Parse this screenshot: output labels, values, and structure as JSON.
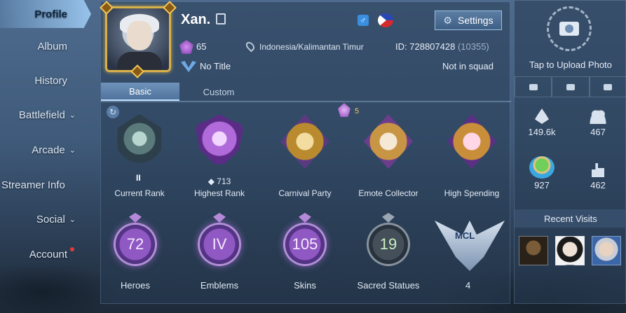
{
  "nav": {
    "items": [
      {
        "label": "Profile",
        "active": true,
        "chevron": false
      },
      {
        "label": "Album",
        "active": false,
        "chevron": false
      },
      {
        "label": "History",
        "active": false,
        "chevron": false
      },
      {
        "label": "Battlefield",
        "active": false,
        "chevron": true
      },
      {
        "label": "Arcade",
        "active": false,
        "chevron": true
      },
      {
        "label": "Streamer Info",
        "active": false,
        "chevron": false
      },
      {
        "label": "Social",
        "active": false,
        "chevron": true
      },
      {
        "label": "Account",
        "active": false,
        "chevron": false,
        "notification_dot": true
      }
    ]
  },
  "profile": {
    "name": "Xan.",
    "level": "65",
    "location": "Indonesia/Kalimantan Timur",
    "id_label": "ID:",
    "id_value": "728807428",
    "server": "(10355)",
    "title": "No Title",
    "squad": "Not in squad",
    "settings_label": "Settings",
    "gender_icon": "male-icon",
    "flag_icon": "philippines-flag-icon"
  },
  "tabs": [
    {
      "label": "Basic",
      "active": true
    },
    {
      "label": "Custom",
      "active": false
    }
  ],
  "achievements": [
    {
      "label": "Current Rank",
      "numeral": "II"
    },
    {
      "label": "Highest Rank",
      "count": "713",
      "star_count": "5"
    },
    {
      "label": "Carnival Party"
    },
    {
      "label": "Emote Collector"
    },
    {
      "label": "High Spending"
    }
  ],
  "stats": [
    {
      "label": "Heroes",
      "value": "72"
    },
    {
      "label": "Emblems",
      "value": "IV"
    },
    {
      "label": "Skins",
      "value": "105"
    },
    {
      "label": "Sacred Statues",
      "value": "19"
    },
    {
      "label": "4",
      "emblem_text": "MCL"
    }
  ],
  "right_panel": {
    "upload_label": "Tap to Upload Photo",
    "popularity": "149.6k",
    "followers": "467",
    "island": "927",
    "likes": "462",
    "recent_visits_label": "Recent Visits"
  },
  "colors": {
    "accent": "#a9d2f5",
    "gold": "#d8b04a",
    "purple": "#b06ad9"
  }
}
